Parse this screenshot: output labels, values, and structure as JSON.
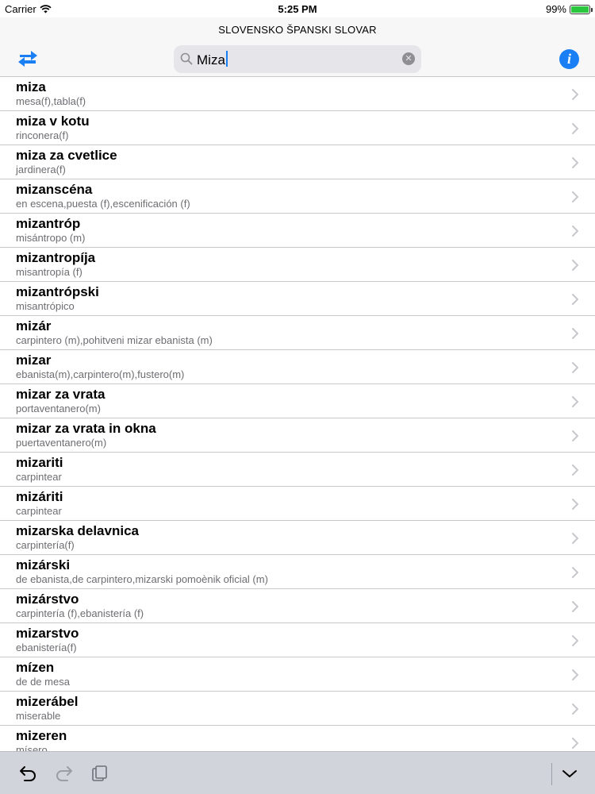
{
  "status_bar": {
    "carrier": "Carrier",
    "time": "5:25 PM",
    "battery": "99%",
    "battery_level": 0.99
  },
  "header": {
    "title": "SLOVENSKO ŠPANSKI SLOVAR",
    "info_label": "i",
    "swap_icon": "swap-arrows-icon",
    "accent_color": "#1a7ef5"
  },
  "search": {
    "value": "Miza"
  },
  "results": [
    {
      "word": "miza",
      "translation": "mesa(f),tabla(f)"
    },
    {
      "word": "miza v kotu",
      "translation": "rinconera(f)"
    },
    {
      "word": "miza za cvetlice",
      "translation": "jardinera(f)"
    },
    {
      "word": "mizanscéna",
      "translation": "en escena,puesta (f),escenificación (f)"
    },
    {
      "word": "mizantróp",
      "translation": "misántropo (m)"
    },
    {
      "word": "mizantropíja",
      "translation": "misantropía (f)"
    },
    {
      "word": "mizantrópski",
      "translation": "misantrópico"
    },
    {
      "word": "mizár",
      "translation": "carpintero (m),pohitveni mizar ebanista (m)"
    },
    {
      "word": "mizar",
      "translation": "ebanista(m),carpintero(m),fustero(m)"
    },
    {
      "word": "mizar za vrata",
      "translation": "portaventanero(m)"
    },
    {
      "word": "mizar za vrata in okna",
      "translation": "puertaventanero(m)"
    },
    {
      "word": "mizariti",
      "translation": "carpintear"
    },
    {
      "word": "mizáriti",
      "translation": "carpintear"
    },
    {
      "word": "mizarska delavnica",
      "translation": "carpintería(f)"
    },
    {
      "word": "mizárski",
      "translation": "de ebanista,de carpintero,mizarski pomoènik oficial (m)"
    },
    {
      "word": "mizárstvo",
      "translation": "carpintería (f),ebanistería (f)"
    },
    {
      "word": "mizarstvo",
      "translation": "ebanistería(f)"
    },
    {
      "word": "mízen",
      "translation": "de de mesa"
    },
    {
      "word": "mizerábel",
      "translation": "miserable"
    },
    {
      "word": "mizeren",
      "translation": "mísero"
    }
  ],
  "toolbar": {
    "undo_icon": "undo-icon",
    "redo_icon": "redo-icon",
    "paste_icon": "clipboard-icon",
    "dismiss_icon": "chevron-down-icon"
  }
}
